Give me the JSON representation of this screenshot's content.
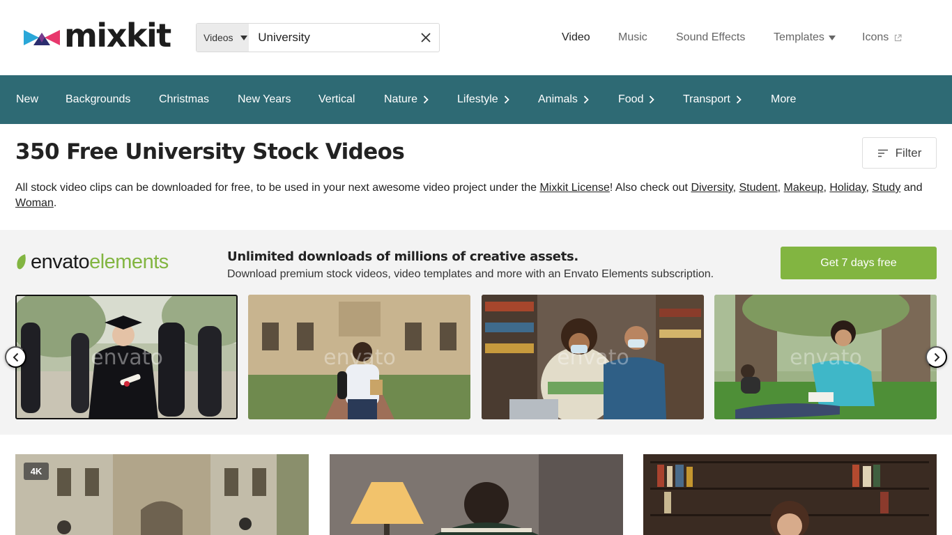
{
  "header": {
    "brand": "mixkit",
    "search": {
      "type_label": "Videos",
      "value": "University",
      "placeholder": "Search"
    },
    "nav": [
      {
        "label": "Video",
        "active": true
      },
      {
        "label": "Music"
      },
      {
        "label": "Sound Effects"
      },
      {
        "label": "Templates",
        "has_dropdown": true
      },
      {
        "label": "Icons",
        "external": true
      }
    ]
  },
  "categories": [
    {
      "label": "New"
    },
    {
      "label": "Backgrounds"
    },
    {
      "label": "Christmas"
    },
    {
      "label": "New Years"
    },
    {
      "label": "Vertical"
    },
    {
      "label": "Nature",
      "has_submenu": true
    },
    {
      "label": "Lifestyle",
      "has_submenu": true
    },
    {
      "label": "Animals",
      "has_submenu": true
    },
    {
      "label": "Food",
      "has_submenu": true
    },
    {
      "label": "Transport",
      "has_submenu": true
    },
    {
      "label": "More"
    }
  ],
  "page": {
    "title": "350 Free University Stock Videos",
    "filter_label": "Filter",
    "description": {
      "intro": "All stock video clips can be downloaded for free, to be used in your next awesome video project under the ",
      "license_link": "Mixkit License",
      "after_license": "! Also check out ",
      "related": [
        "Diversity",
        "Student",
        "Makeup",
        "Holiday",
        "Study"
      ],
      "sep": ", ",
      "and_word": " and ",
      "last_related": "Woman",
      "end": "."
    }
  },
  "promo": {
    "logo_part1": "envato",
    "logo_part2": "elements",
    "headline": "Unlimited downloads of millions of creative assets.",
    "subtext": "Download premium stock videos, video templates and more with an Envato Elements subscription.",
    "cta": "Get 7 days free",
    "watermark": "envato",
    "thumbnails": [
      {
        "name": "graduates-in-park"
      },
      {
        "name": "student-walking-campus"
      },
      {
        "name": "students-studying-masks"
      },
      {
        "name": "girl-reading-under-tree"
      }
    ]
  },
  "results": [
    {
      "badge": "4K",
      "name": "university-building"
    },
    {
      "name": "student-at-desk-lamp"
    },
    {
      "name": "student-in-library"
    }
  ],
  "colors": {
    "category_bar": "#2e6a74",
    "cta_green": "#82b541",
    "logo_pink": "#e8386d",
    "logo_blue": "#2aa7d8",
    "logo_navy": "#2b2d6e"
  }
}
